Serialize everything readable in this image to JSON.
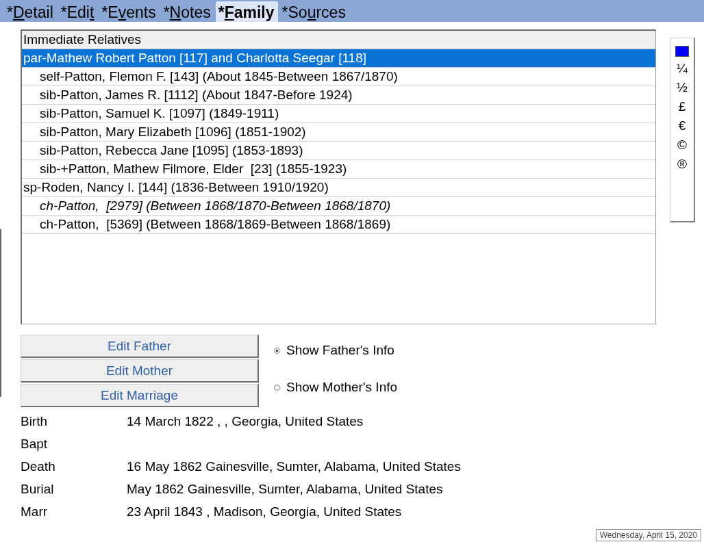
{
  "tabs": [
    {
      "label_start": "*",
      "access_key": "D",
      "label_end": "etail",
      "selected": false
    },
    {
      "label_start": "*Edi",
      "access_key": "t",
      "selected": false
    },
    {
      "label_start": "*E",
      "access_key": "v",
      "label_end": "ents",
      "selected": false
    },
    {
      "label_start": "*",
      "access_key": "N",
      "label_end": "otes",
      "selected": false
    },
    {
      "label_start": "*",
      "access_key": "F",
      "label_end": "amily",
      "selected": true
    },
    {
      "label_start": "*So",
      "access_key": "u",
      "label_end": "rces",
      "selected": false
    }
  ],
  "relatives": {
    "header": "Immediate Relatives",
    "rows": [
      {
        "text": "par-Mathew Robert Patton [117] and Charlotta Seegar [118]",
        "selected": true,
        "italic": false,
        "children": [
          {
            "text": "self-Patton, Flemon F. [143] (About 1845-Between 1867/1870)",
            "selected": false,
            "italic": false
          },
          {
            "text": "sib-Patton, James R. [1112] (About 1847-Before 1924)",
            "selected": false,
            "italic": false
          },
          {
            "text": "sib-Patton, Samuel K. [1097] (1849-1911)",
            "selected": false,
            "italic": false
          },
          {
            "text": "sib-Patton, Mary Elizabeth [1096] (1851-1902)",
            "selected": false,
            "italic": false
          },
          {
            "text": "sib-Patton, Rebecca Jane [1095] (1853-1893)",
            "selected": false,
            "italic": false
          },
          {
            "text": "sib-+Patton, Mathew Filmore, Elder  [23] (1855-1923)",
            "selected": false,
            "italic": false
          }
        ]
      },
      {
        "text": "sp-Roden, Nancy I. [144] (1836-Between 1910/1920)",
        "selected": false,
        "italic": false,
        "children": [
          {
            "text": "ch-Patton,  [2979] (Between 1868/1870-Between 1868/1870)",
            "selected": false,
            "italic": true
          },
          {
            "text": "ch-Patton,  [5369] (Between 1868/1869-Between 1868/1869)",
            "selected": false,
            "italic": false
          }
        ]
      }
    ]
  },
  "symbols": [
    {
      "kind": "swatch",
      "color": "#0000ff"
    },
    {
      "kind": "char",
      "text": "¼"
    },
    {
      "kind": "char",
      "text": "½"
    },
    {
      "kind": "char",
      "text": "£"
    },
    {
      "kind": "char",
      "text": "€"
    },
    {
      "kind": "char",
      "text": "©"
    },
    {
      "kind": "char",
      "text": "®"
    }
  ],
  "buttons": [
    "Edit Father",
    "Edit Mother",
    "Edit Marriage"
  ],
  "radios": [
    {
      "label": "Show Father's Info",
      "selected": true
    },
    {
      "label": "Show Mother's Info",
      "selected": false
    }
  ],
  "events": [
    {
      "label": "Birth",
      "value": "14 March 1822 , , Georgia, United States"
    },
    {
      "label": "Bapt"
    },
    {
      "label": "Death",
      "value": "16 May 1862 Gainesville, Sumter, Alabama, United States"
    },
    {
      "label": "Burial",
      "value": "May 1862 Gainesville, Sumter, Alabama, United States"
    },
    {
      "label": "Marr",
      "value": "23 April 1843 , Madison, Georgia, United States"
    }
  ],
  "status_date": "Wednesday, April 15, 2020"
}
